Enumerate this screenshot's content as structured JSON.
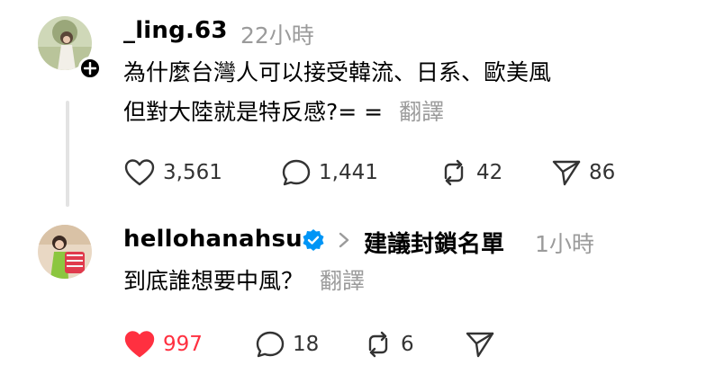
{
  "comments": [
    {
      "username": "_ling.63",
      "time": "22小時",
      "text_line1": "為什麼台灣人可以接受韓流、日系、歐美風",
      "text_line2": "但對大陸就是特反感?= =",
      "translate": "翻譯",
      "likes": "3,561",
      "replies": "1,441",
      "reposts": "42",
      "shares": "86",
      "liked": false
    },
    {
      "username": "hellohanahsu",
      "verified": true,
      "reply_to": "建議封鎖名單",
      "time": "1小時",
      "text_line1": "到底誰想要中風？",
      "translate": "翻譯",
      "likes": "997",
      "replies": "18",
      "reposts": "6",
      "liked": true
    }
  ],
  "icons": {
    "like": "heart-icon",
    "reply": "comment-icon",
    "repost": "repost-icon",
    "share": "send-icon",
    "follow": "plus-icon",
    "verified": "verified-badge-icon"
  },
  "colors": {
    "liked": "#ff3040",
    "muted": "#9b9b9b",
    "verified": "#0095f6"
  }
}
